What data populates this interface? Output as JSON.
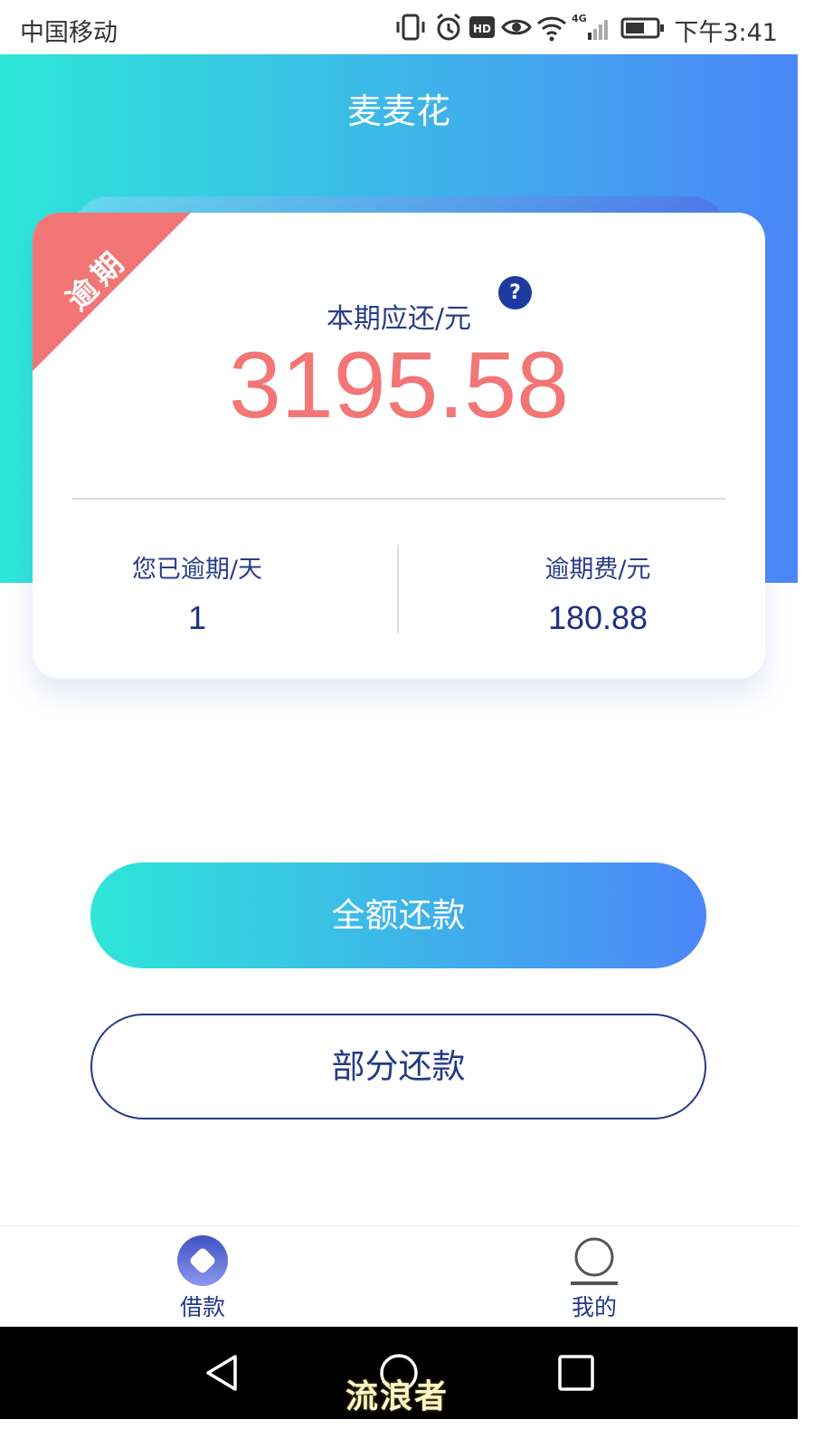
{
  "status_bar": {
    "carrier": "中国移动",
    "network": "4G",
    "time": "下午3:41",
    "icons": [
      "vibrate-icon",
      "alarm-icon",
      "hd-icon",
      "eye-icon",
      "wifi-icon",
      "signal-icon",
      "battery-icon"
    ]
  },
  "header": {
    "title": "麦麦花"
  },
  "card": {
    "badge": "逾期",
    "due_label": "本期应还/元",
    "help_symbol": "?",
    "due_amount": "3195.58",
    "overdue_days_label": "您已逾期/天",
    "overdue_days_value": "1",
    "overdue_fee_label": "逾期费/元",
    "overdue_fee_value": "180.88"
  },
  "actions": {
    "full_repay": "全额还款",
    "partial_repay": "部分还款"
  },
  "tabs": [
    {
      "label": "借款",
      "icon": "loan-icon",
      "active": true
    },
    {
      "label": "我的",
      "icon": "profile-icon",
      "active": false
    }
  ],
  "watermark": "流浪者",
  "colors": {
    "gradient_start": "#2ee6d8",
    "gradient_end": "#4c86f8",
    "amount_red": "#f27676",
    "navy": "#253a86"
  }
}
